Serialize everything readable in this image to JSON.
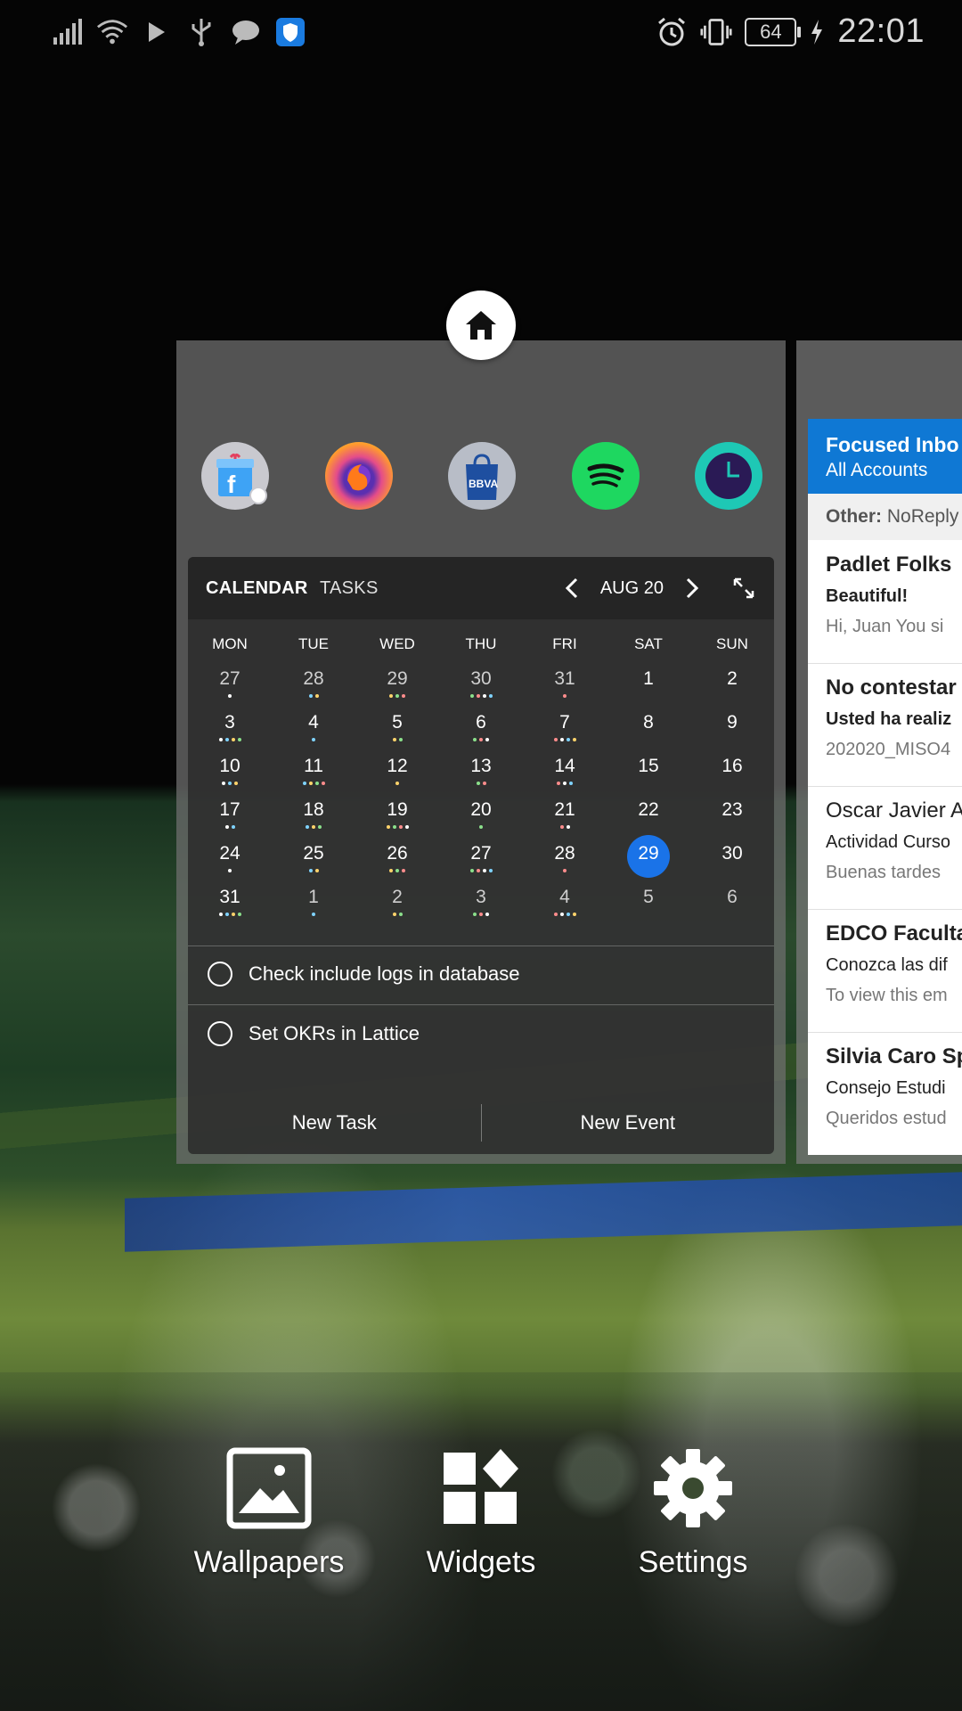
{
  "status_bar": {
    "battery": "64",
    "time": "22:01"
  },
  "home_screen": {
    "apps": [
      {
        "name": "facebook-icon"
      },
      {
        "name": "firefox-icon"
      },
      {
        "name": "bbva-icon",
        "label": "BBVA"
      },
      {
        "name": "spotify-icon"
      },
      {
        "name": "clock-icon"
      }
    ]
  },
  "calendar": {
    "tab_calendar": "CALENDAR",
    "tab_tasks": "TASKS",
    "month": "AUG 20",
    "days_of_week": [
      "MON",
      "TUE",
      "WED",
      "THU",
      "FRI",
      "SAT",
      "SUN"
    ],
    "weeks": [
      [
        "27",
        "28",
        "29",
        "30",
        "31",
        "1",
        "2"
      ],
      [
        "3",
        "4",
        "5",
        "6",
        "7",
        "8",
        "9"
      ],
      [
        "10",
        "11",
        "12",
        "13",
        "14",
        "15",
        "16"
      ],
      [
        "17",
        "18",
        "19",
        "20",
        "21",
        "22",
        "23"
      ],
      [
        "24",
        "25",
        "26",
        "27",
        "28",
        "29",
        "30"
      ],
      [
        "31",
        "1",
        "2",
        "3",
        "4",
        "5",
        "6"
      ]
    ],
    "today": "29",
    "tasks": [
      {
        "label": "Check include logs in database"
      },
      {
        "label": "Set OKRs in Lattice"
      }
    ],
    "new_task": "New Task",
    "new_event": "New Event",
    "colors": {
      "today": "#1a73e8"
    }
  },
  "mail": {
    "title": "Focused Inbo",
    "subtitle": "All Accounts",
    "other_label": "Other:",
    "other_value": "NoReply",
    "items": [
      {
        "from": "Padlet Folks",
        "subject": "Beautiful!",
        "preview": "Hi, Juan You si"
      },
      {
        "from": "No contestar",
        "subject": "Usted ha realiz",
        "preview": "202020_MISO4"
      },
      {
        "from": "Oscar Javier A",
        "subject": "Actividad Curso",
        "preview": "Buenas tardes"
      },
      {
        "from": "EDCO Faculta",
        "subject": "Conozca las dif",
        "preview": "To view this em"
      },
      {
        "from": "Silvia Caro Sp",
        "subject": "Consejo Estudi",
        "preview": "Queridos estud"
      }
    ],
    "colors": {
      "header": "#0f78d4"
    }
  },
  "bottom_options": {
    "wallpapers": "Wallpapers",
    "widgets": "Widgets",
    "settings": "Settings"
  }
}
